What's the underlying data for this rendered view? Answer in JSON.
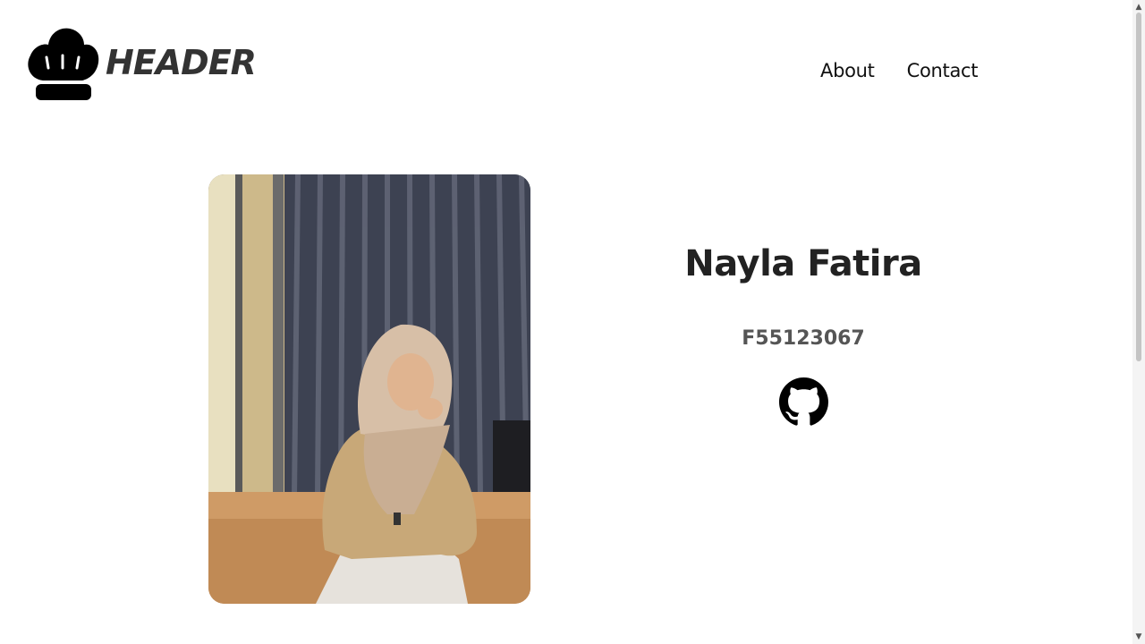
{
  "header": {
    "logo_text": "HEADER",
    "logo_icon": "chef-hat-icon",
    "nav": [
      {
        "label": "About"
      },
      {
        "label": "Contact"
      }
    ]
  },
  "profile": {
    "name": "Nayla Fatira",
    "id": "F55123067",
    "github_icon": "github-icon"
  },
  "colors": {
    "text_dark": "#222222",
    "text_muted": "#555555",
    "background": "#ffffff"
  }
}
